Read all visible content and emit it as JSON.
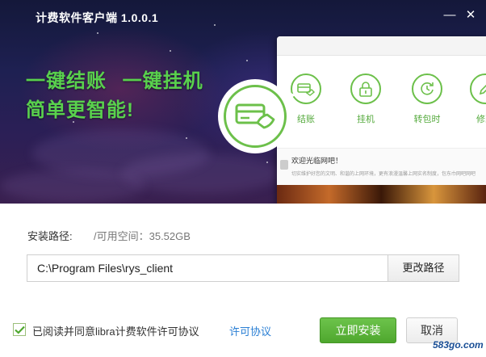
{
  "window": {
    "title": "计费软件客户端 1.0.0.1",
    "minimize_glyph": "—",
    "close_glyph": "✕"
  },
  "hero": {
    "slogan_line1": "一键结账  一键挂机",
    "slogan_line2": "简单更智能!",
    "bubble_icon": "card-payment-icon",
    "preview": {
      "features": [
        {
          "label": "结账",
          "icon": "card-payment-icon"
        },
        {
          "label": "挂机",
          "icon": "lock-icon"
        },
        {
          "label": "转包时",
          "icon": "clock-refresh-icon"
        },
        {
          "label": "修改",
          "icon": "edit-icon"
        }
      ],
      "welcome_title": "欢迎光临网吧！",
      "welcome_sub": "切实维护好您的文明、和谐的上网环境，更有浪漫温馨上网实名制度，包东巾网吧网吧"
    }
  },
  "install": {
    "path_label": "安装路径:",
    "space_label": "/可用空间：35.52GB",
    "path_value": "C:\\Program Files\\rys_client",
    "browse_label": "更改路径",
    "agree_checked": true,
    "agree_text": "已阅读并同意libra计费软件许可协议",
    "license_link": "许可协议",
    "install_label": "立即安装",
    "cancel_label": "取消"
  },
  "watermark": "583go.com",
  "colors": {
    "accent_green": "#59d14d",
    "button_green": "#4ea72e",
    "link_blue": "#2a7fd4"
  }
}
